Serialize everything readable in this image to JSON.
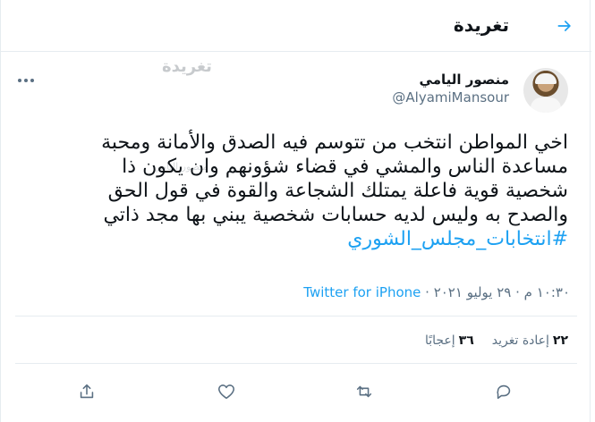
{
  "header": {
    "title": "تغريدة"
  },
  "ghosts": {
    "g1": "تغريدة",
    "g2": "منصور اليامي"
  },
  "author": {
    "name": "منصور اليامي",
    "handle": "@AlyamiMansour"
  },
  "tweet": {
    "lines": [
      "اخي المواطن انتخب من تتوسم فيه الصدق والأمانة ومحبة",
      "مساعدة الناس والمشي في قضاء شؤونهم وان يكون ذا",
      "شخصية قوية فاعلة يمتلك الشجاعة والقوة في قول الحق",
      "والصدح به وليس لديه حسابات شخصية يبني بها مجد ذاتي"
    ],
    "hashtag": "#انتخابات_مجلس_الشوري"
  },
  "meta": {
    "time": "١٠:٣٠ م · ٢٩ يوليو ٢٠٢١ · ",
    "source": "Twitter for iPhone"
  },
  "stats": {
    "retweets_count": "٢٢",
    "retweets_label": "إعادة تغريد",
    "likes_count": "٣٦",
    "likes_label": "إعجابًا"
  },
  "icons": {
    "back": "arrow-right-icon",
    "more": "more-dots-icon",
    "reply": "reply-icon",
    "retweet": "retweet-icon",
    "like": "heart-icon",
    "share": "share-icon"
  },
  "colors": {
    "accent": "#1da1f2",
    "secondary_text": "#5b7083",
    "border": "#e6ecf0"
  }
}
